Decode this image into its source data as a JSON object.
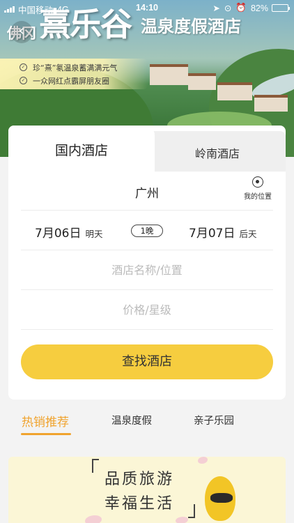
{
  "status_bar": {
    "carrier": "中国移动",
    "network": "4G",
    "time": "14:10",
    "battery": "82%",
    "battery_level": 0.82
  },
  "banner": {
    "title_small": "佛冈",
    "title_big": "熹乐谷",
    "title_sub": "温泉度假酒店",
    "slogans": [
      "珍“熹”氡温泉蓄满满元气",
      "一众网红点霸屏朋友圈"
    ]
  },
  "tabs": {
    "active": "国内酒店",
    "inactive": "岭南酒店"
  },
  "search": {
    "city": "广州",
    "my_location_label": "我的位置",
    "checkin_date": "7月06日",
    "checkin_day": "明天",
    "nights": "1晚",
    "checkout_date": "7月07日",
    "checkout_day": "后天",
    "name_placeholder": "酒店名称/位置",
    "price_placeholder": "价格/星级",
    "button_label": "查找酒店"
  },
  "categories": [
    {
      "label": "热销推荐",
      "active": true
    },
    {
      "label": "温泉度假",
      "active": false
    },
    {
      "label": "亲子乐园",
      "active": false
    }
  ],
  "promo": {
    "line1": "品质旅游",
    "line2": "幸福生活"
  },
  "colors": {
    "accent": "#f0a32e",
    "button": "#f6cd3f"
  }
}
